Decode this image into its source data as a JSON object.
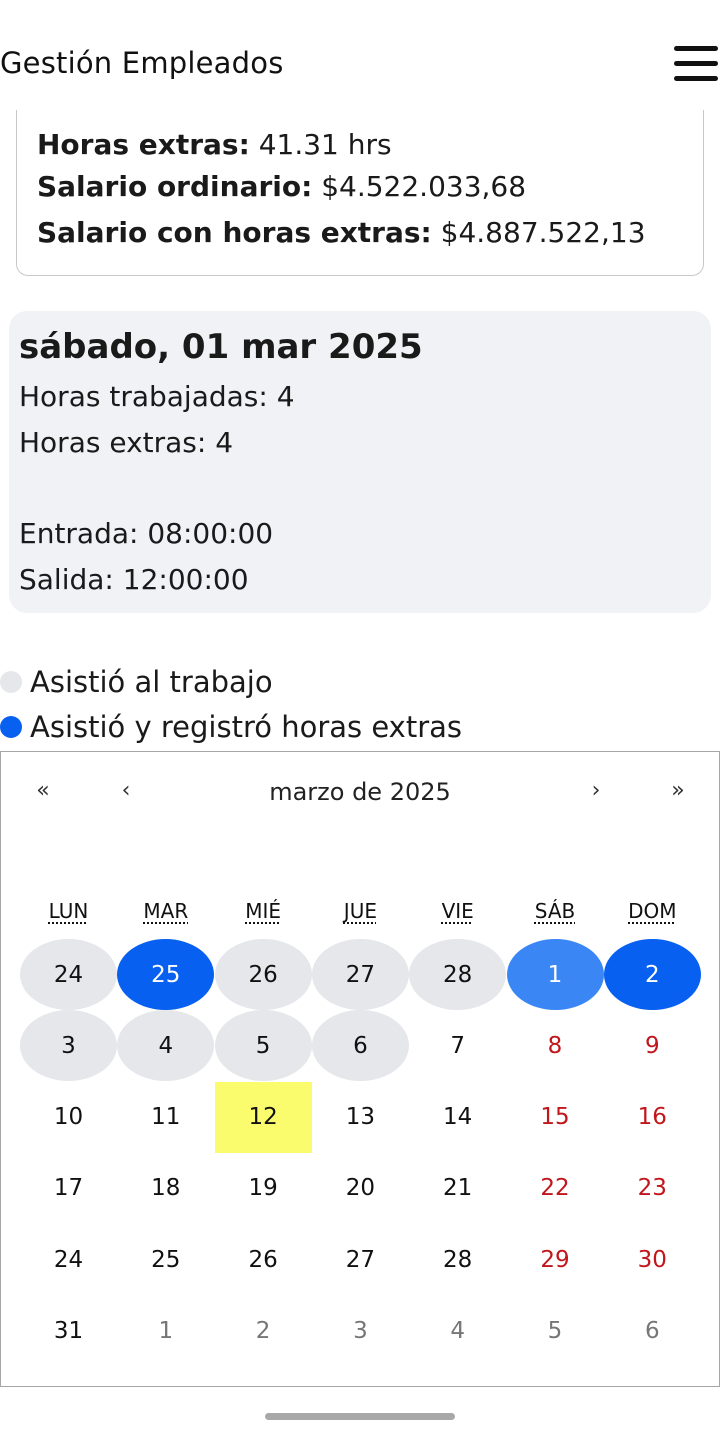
{
  "header": {
    "title": "Gestión Empleados"
  },
  "summary": {
    "overtime_label": "Horas extras:",
    "overtime_value": "41.31 hrs",
    "ordinary_label": "Salario ordinario:",
    "ordinary_value": "$4.522.033,68",
    "total_label": "Salario con horas extras:",
    "total_value": "$4.887.522,13"
  },
  "day_detail": {
    "title": "sábado, 01 mar 2025",
    "hours_worked": "Horas trabajadas: 4",
    "overtime": "Horas extras: 4",
    "entry": "Entrada: 08:00:00",
    "exit": "Salida: 12:00:00"
  },
  "legend": [
    {
      "label": "Asistió al trabajo",
      "color": "#e5e7ea"
    },
    {
      "label": "Asistió y registró horas extras",
      "color": "#0860f0"
    }
  ],
  "calendar": {
    "prev_year": "«",
    "prev_month": "‹",
    "month_label": "marzo de 2025",
    "next_month": "›",
    "next_year": "»",
    "weekdays": [
      "LUN",
      "MAR",
      "MIÉ",
      "JUE",
      "VIE",
      "SÁB",
      "DOM"
    ],
    "weeks": [
      [
        {
          "d": "24",
          "s": "attended"
        },
        {
          "d": "25",
          "s": "extra"
        },
        {
          "d": "26",
          "s": "attended"
        },
        {
          "d": "27",
          "s": "attended"
        },
        {
          "d": "28",
          "s": "attended"
        },
        {
          "d": "1",
          "s": "selected"
        },
        {
          "d": "2",
          "s": "extra"
        }
      ],
      [
        {
          "d": "3",
          "s": "attended"
        },
        {
          "d": "4",
          "s": "attended"
        },
        {
          "d": "5",
          "s": "attended"
        },
        {
          "d": "6",
          "s": "attended"
        },
        {
          "d": "7",
          "s": ""
        },
        {
          "d": "8",
          "s": "weekend"
        },
        {
          "d": "9",
          "s": "weekend"
        }
      ],
      [
        {
          "d": "10",
          "s": ""
        },
        {
          "d": "11",
          "s": ""
        },
        {
          "d": "12",
          "s": "today"
        },
        {
          "d": "13",
          "s": ""
        },
        {
          "d": "14",
          "s": ""
        },
        {
          "d": "15",
          "s": "weekend"
        },
        {
          "d": "16",
          "s": "weekend"
        }
      ],
      [
        {
          "d": "17",
          "s": ""
        },
        {
          "d": "18",
          "s": ""
        },
        {
          "d": "19",
          "s": ""
        },
        {
          "d": "20",
          "s": ""
        },
        {
          "d": "21",
          "s": ""
        },
        {
          "d": "22",
          "s": "weekend"
        },
        {
          "d": "23",
          "s": "weekend"
        }
      ],
      [
        {
          "d": "24",
          "s": ""
        },
        {
          "d": "25",
          "s": ""
        },
        {
          "d": "26",
          "s": ""
        },
        {
          "d": "27",
          "s": ""
        },
        {
          "d": "28",
          "s": ""
        },
        {
          "d": "29",
          "s": "weekend"
        },
        {
          "d": "30",
          "s": "weekend"
        }
      ],
      [
        {
          "d": "31",
          "s": ""
        },
        {
          "d": "1",
          "s": "other"
        },
        {
          "d": "2",
          "s": "other"
        },
        {
          "d": "3",
          "s": "other"
        },
        {
          "d": "4",
          "s": "other"
        },
        {
          "d": "5",
          "s": "other"
        },
        {
          "d": "6",
          "s": "other"
        }
      ]
    ]
  }
}
